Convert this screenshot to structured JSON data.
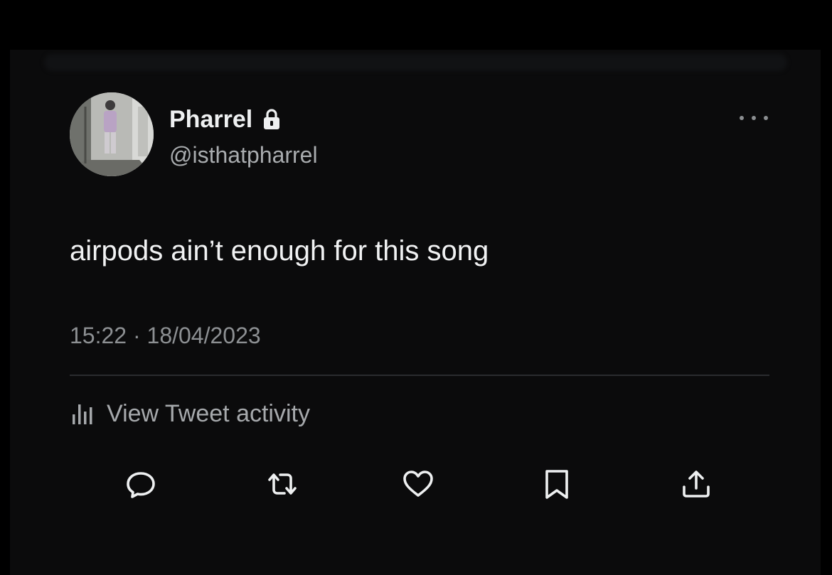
{
  "tweet": {
    "author": {
      "display_name": "Pharrel",
      "handle": "@isthatpharrel",
      "protected_icon": "lock-icon"
    },
    "text": "airpods ain’t enough for this song",
    "timestamp": "15:22 · 18/04/2023",
    "activity_label": "View Tweet activity",
    "actions": [
      "reply-icon",
      "retweet-icon",
      "like-icon",
      "bookmark-icon",
      "share-icon"
    ],
    "colors": {
      "background": "#0b0b0c",
      "text_primary": "#eef0f1",
      "text_secondary": "#8d9093"
    }
  }
}
